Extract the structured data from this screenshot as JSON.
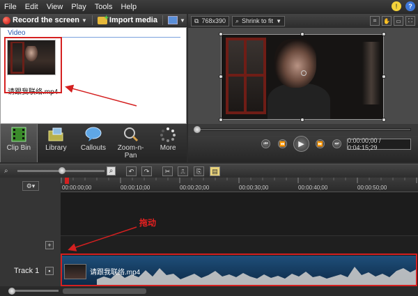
{
  "menubar": {
    "items": [
      "File",
      "Edit",
      "View",
      "Play",
      "Tools",
      "Help"
    ]
  },
  "toolbar": {
    "record_label": "Record the screen",
    "import_label": "Import media"
  },
  "clipbin": {
    "section_label": "Video",
    "clip_name": "请跟我联络.mp4"
  },
  "tabs": [
    {
      "label": "Clip Bin",
      "icon": "film-strip-icon"
    },
    {
      "label": "Library",
      "icon": "library-folder-icon"
    },
    {
      "label": "Callouts",
      "icon": "speech-bubble-icon"
    },
    {
      "label": "Zoom-n-\nPan",
      "icon": "magnifier-icon"
    },
    {
      "label": "More",
      "icon": "more-dots-icon"
    }
  ],
  "preview": {
    "dimensions": "768x390",
    "scale_mode": "Shrink to fit",
    "timecode": "0:00:00;00 / 0:04:15;29"
  },
  "timeline": {
    "ruler_ticks": [
      "00:00:00;00",
      "00:00:10;00",
      "00:00:20;00",
      "00:00:30;00",
      "00:00:40;00",
      "00:00:50;00"
    ],
    "track_label": "Track 1",
    "clip_label": "请跟我联络.mp4"
  },
  "annotations": {
    "drag_text": "拖动"
  },
  "colors": {
    "highlight": "#d42020",
    "clip_strip": "#1e4f7a",
    "accent_link": "#2a57b0"
  }
}
